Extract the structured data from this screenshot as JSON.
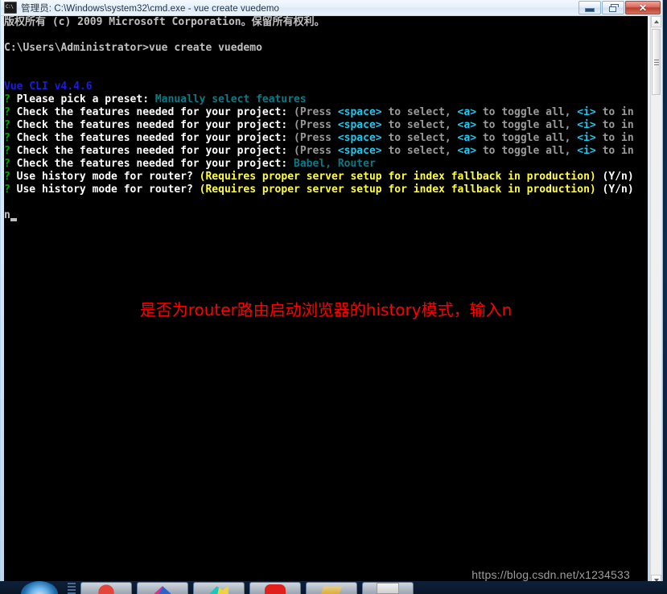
{
  "window": {
    "title": "管理员: C:\\Windows\\system32\\cmd.exe - vue  create vuedemo",
    "icon_name": "cmd-icon",
    "buttons": {
      "minimize": "—",
      "restore": "❐",
      "close": "✕"
    }
  },
  "console": {
    "lines": [
      [
        {
          "text": "版权所有 (c) 2009 Microsoft Corporation。保留所有权利。",
          "color": "white"
        }
      ],
      [],
      [
        {
          "text": "C:\\Users\\Administrator>vue create vuedemo",
          "color": "white"
        }
      ],
      [],
      [],
      [
        {
          "text": "Vue CLI v4.4.6",
          "color": "blue"
        }
      ],
      [
        {
          "text": "? ",
          "color": "green"
        },
        {
          "text": "Please pick a preset: ",
          "color": "bwhite"
        },
        {
          "text": "Manually select features",
          "color": "teal"
        }
      ],
      [
        {
          "text": "? ",
          "color": "green"
        },
        {
          "text": "Check the features needed for your project: ",
          "color": "bwhite"
        },
        {
          "text": "(Press ",
          "color": "gray"
        },
        {
          "text": "<space>",
          "color": "cyan"
        },
        {
          "text": " to select, ",
          "color": "gray"
        },
        {
          "text": "<a>",
          "color": "cyan"
        },
        {
          "text": " to toggle all, ",
          "color": "gray"
        },
        {
          "text": "<i>",
          "color": "cyan"
        },
        {
          "text": " to in",
          "color": "gray"
        }
      ],
      [
        {
          "text": "? ",
          "color": "green"
        },
        {
          "text": "Check the features needed for your project: ",
          "color": "bwhite"
        },
        {
          "text": "(Press ",
          "color": "gray"
        },
        {
          "text": "<space>",
          "color": "cyan"
        },
        {
          "text": " to select, ",
          "color": "gray"
        },
        {
          "text": "<a>",
          "color": "cyan"
        },
        {
          "text": " to toggle all, ",
          "color": "gray"
        },
        {
          "text": "<i>",
          "color": "cyan"
        },
        {
          "text": " to in",
          "color": "gray"
        }
      ],
      [
        {
          "text": "? ",
          "color": "green"
        },
        {
          "text": "Check the features needed for your project: ",
          "color": "bwhite"
        },
        {
          "text": "(Press ",
          "color": "gray"
        },
        {
          "text": "<space>",
          "color": "cyan"
        },
        {
          "text": " to select, ",
          "color": "gray"
        },
        {
          "text": "<a>",
          "color": "cyan"
        },
        {
          "text": " to toggle all, ",
          "color": "gray"
        },
        {
          "text": "<i>",
          "color": "cyan"
        },
        {
          "text": " to in",
          "color": "gray"
        }
      ],
      [
        {
          "text": "? ",
          "color": "green"
        },
        {
          "text": "Check the features needed for your project: ",
          "color": "bwhite"
        },
        {
          "text": "(Press ",
          "color": "gray"
        },
        {
          "text": "<space>",
          "color": "cyan"
        },
        {
          "text": " to select, ",
          "color": "gray"
        },
        {
          "text": "<a>",
          "color": "cyan"
        },
        {
          "text": " to toggle all, ",
          "color": "gray"
        },
        {
          "text": "<i>",
          "color": "cyan"
        },
        {
          "text": " to in",
          "color": "gray"
        }
      ],
      [
        {
          "text": "? ",
          "color": "green"
        },
        {
          "text": "Check the features needed for your project: ",
          "color": "bwhite"
        },
        {
          "text": "Babel, Router",
          "color": "teal"
        }
      ],
      [
        {
          "text": "? ",
          "color": "green"
        },
        {
          "text": "Use history mode for router? ",
          "color": "bwhite"
        },
        {
          "text": "(Requires proper server setup for index fallback in production)",
          "color": "yellow"
        },
        {
          "text": " (Y/n)",
          "color": "bwhite"
        }
      ],
      [
        {
          "text": "? ",
          "color": "green"
        },
        {
          "text": "Use history mode for router? ",
          "color": "bwhite"
        },
        {
          "text": "(Requires proper server setup for index fallback in production)",
          "color": "yellow"
        },
        {
          "text": " (Y/n)",
          "color": "bwhite"
        }
      ],
      [],
      [
        {
          "text": "n",
          "color": "white",
          "cursor": true
        }
      ]
    ]
  },
  "annotation": {
    "text": "是否为router路由启动浏览器的history模式，输入n",
    "color": "#ff0000"
  },
  "watermark": {
    "text": "https://blog.csdn.net/x1234533"
  },
  "scrollbar": {
    "up_arrow": "scroll-up-arrow",
    "down_arrow": "scroll-down-arrow",
    "thumb": "scroll-thumb"
  },
  "taskbar": {
    "start": "start-orb",
    "items": [
      {
        "name": "taskbar-item-1",
        "icon": "ico-a"
      },
      {
        "name": "taskbar-item-2",
        "icon": "ico-b"
      },
      {
        "name": "taskbar-item-3",
        "icon": "ico-c"
      },
      {
        "name": "taskbar-item-4",
        "icon": "ico-d"
      },
      {
        "name": "taskbar-item-5",
        "icon": "ico-e"
      },
      {
        "name": "taskbar-item-6",
        "icon": "ico-f"
      }
    ]
  }
}
